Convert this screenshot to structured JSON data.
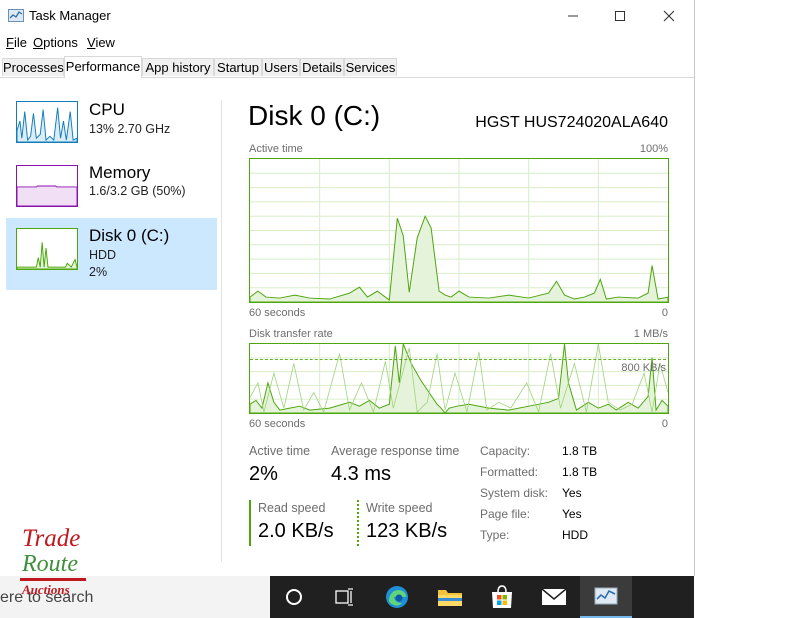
{
  "window": {
    "title": "Task Manager"
  },
  "menu": [
    {
      "label": "File",
      "accel": "F",
      "rest": "ile"
    },
    {
      "label": "Options",
      "accel": "O",
      "rest": "ptions"
    },
    {
      "label": "View",
      "accel": "V",
      "rest": "iew"
    }
  ],
  "tabs": [
    "Processes",
    "Performance",
    "App history",
    "Startup",
    "Users",
    "Details",
    "Services"
  ],
  "active_tab": "Performance",
  "sidebar": {
    "items": [
      {
        "name": "CPU",
        "sub": "13%  2.70 GHz",
        "color": "#117dbb"
      },
      {
        "name": "Memory",
        "sub": "1.6/3.2 GB (50%)",
        "color": "#8b12ae"
      },
      {
        "name": "Disk 0 (C:)",
        "sub": "HDD",
        "sub2": "2%",
        "color": "#4da60c"
      }
    ]
  },
  "disk": {
    "title": "Disk 0 (C:)",
    "model": "HGST HUS724020ALA640",
    "active_graph": {
      "label": "Active time",
      "max": "100%",
      "time": "60 seconds",
      "min": "0"
    },
    "transfer_graph": {
      "label": "Disk transfer rate",
      "max": "1 MB/s",
      "mid": "800 KB/s",
      "time": "60 seconds",
      "min": "0"
    },
    "stats": {
      "active_time_label": "Active time",
      "active_time": "2%",
      "avg_resp_label": "Average response time",
      "avg_resp": "4.3 ms",
      "read_label": "Read speed",
      "read": "2.0 KB/s",
      "write_label": "Write speed",
      "write": "123 KB/s"
    },
    "props": [
      {
        "k": "Capacity:",
        "v": "1.8 TB"
      },
      {
        "k": "Formatted:",
        "v": "1.8 TB"
      },
      {
        "k": "System disk:",
        "v": "Yes"
      },
      {
        "k": "Page file:",
        "v": "Yes"
      },
      {
        "k": "Type:",
        "v": "HDD"
      }
    ]
  },
  "taskbar": {
    "search_text": "ere to search"
  },
  "logo": {
    "line1": "Trade",
    "line2": "Route",
    "line3": "Auctions"
  },
  "colors": {
    "disk_green": "#4da60c",
    "cpu_blue": "#117dbb",
    "mem_purple": "#8b12ae",
    "selected_bg": "#cce8ff"
  }
}
